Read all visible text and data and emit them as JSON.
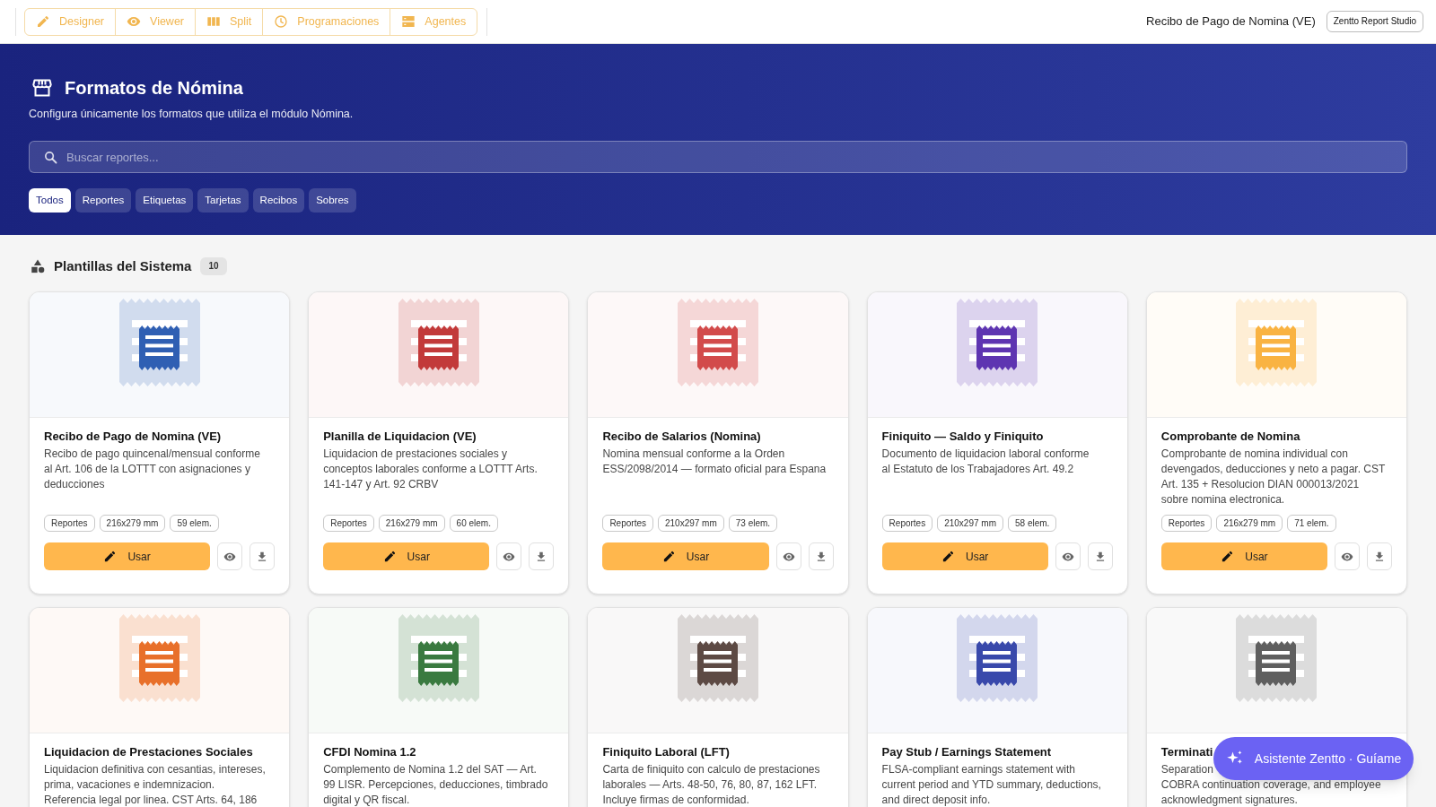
{
  "toolbar": {
    "buttons": [
      {
        "label": "Designer",
        "kind": "edit"
      },
      {
        "label": "Viewer",
        "kind": "view"
      },
      {
        "label": "Split",
        "kind": "split"
      },
      {
        "label": "Programaciones",
        "kind": "schedule"
      },
      {
        "label": "Agentes",
        "kind": "agents"
      }
    ]
  },
  "document_title": "Recibo de Pago de Nomina (VE)",
  "app_badge": "Zentto Report Studio",
  "header": {
    "title": "Formatos de Nómina",
    "subtitle": "Configura únicamente los formatos que utiliza el módulo Nómina.",
    "search": {
      "placeholder": "Buscar reportes..."
    },
    "filters": [
      {
        "label": "Todos",
        "selected": true
      },
      {
        "label": "Reportes",
        "selected": false
      },
      {
        "label": "Etiquetas",
        "selected": false
      },
      {
        "label": "Tarjetas",
        "selected": false
      },
      {
        "label": "Recibos",
        "selected": false
      },
      {
        "label": "Sobres",
        "selected": false
      }
    ]
  },
  "section": {
    "title": "Plantillas del Sistema",
    "count": "10"
  },
  "templates": [
    {
      "title": "Recibo de Pago de Nomina (VE)",
      "description_lines": [
        "Recibo de pago quincenal/mensual conforme",
        "al Art. 106 de la LOTTT con asignaciones y",
        "deducciones"
      ],
      "color": "#2f5fb3",
      "tags": [
        "Reportes",
        "216x279 mm",
        "59 elem."
      ],
      "action": "Usar"
    },
    {
      "title": "Planilla de Liquidacion (VE)",
      "description_lines": [
        "Liquidacion de prestaciones sociales y",
        "conceptos laborales conforme a LOTTT Arts.",
        "141-147 y Art. 92 CRBV"
      ],
      "color": "#c23a3a",
      "tags": [
        "Reportes",
        "216x279 mm",
        "60 elem."
      ],
      "action": "Usar"
    },
    {
      "title": "Recibo de Salarios (Nomina)",
      "description_lines": [
        "Nomina mensual conforme a la Orden",
        "ESS/2098/2014 — formato oficial para Espana"
      ],
      "color": "#d24b4b",
      "tags": [
        "Reportes",
        "210x297 mm",
        "73 elem."
      ],
      "action": "Usar"
    },
    {
      "title": "Finiquito — Saldo y Finiquito",
      "description_lines": [
        "Documento de liquidacion laboral conforme",
        "al Estatuto de los Trabajadores Art. 49.2"
      ],
      "color": "#5e35b1",
      "tags": [
        "Reportes",
        "210x297 mm",
        "58 elem."
      ],
      "action": "Usar"
    },
    {
      "title": "Comprobante de Nomina",
      "description_lines": [
        "Comprobante de nomina individual con",
        "devengados, deducciones y neto a pagar. CST",
        "Art. 135 + Resolucion DIAN 000013/2021",
        "sobre nomina electronica."
      ],
      "color": "#f9b342",
      "tags": [
        "Reportes",
        "216x279 mm",
        "71 elem."
      ],
      "action": "Usar"
    },
    {
      "title": "Liquidacion de Prestaciones Sociales",
      "description_lines": [
        "Liquidacion definitiva con cesantias, intereses,",
        "prima, vacaciones e indemnizacion.",
        "Referencia legal por linea. CST Arts. 64, 186"
      ],
      "color": "#e8702a"
    },
    {
      "title": "CFDI Nomina 1.2",
      "description_lines": [
        "Complemento de Nomina 1.2 del SAT — Art.",
        "99 LISR. Percepciones, deducciones, timbrado",
        "digital y QR fiscal."
      ],
      "color": "#3a7a40"
    },
    {
      "title": "Finiquito Laboral (LFT)",
      "description_lines": [
        "Carta de finiquito con calculo de prestaciones",
        "laborales — Arts. 48-50, 76, 80, 87, 162 LFT.",
        "Incluye firmas de conformidad."
      ],
      "color": "#5d4a44"
    },
    {
      "title": "Pay Stub / Earnings Statement",
      "description_lines": [
        "FLSA-compliant earnings statement with",
        "current period and YTD summary, deductions,",
        "and direct deposit info."
      ],
      "color": "#3949ab"
    },
    {
      "title": "Terminati",
      "description_lines": [
        "Separation",
        "COBRA continuation coverage, and employee",
        "acknowledgment signatures."
      ],
      "color": "#5f5f5f"
    }
  ],
  "assistant": {
    "label": "Asistente Zentto · Guíame"
  }
}
